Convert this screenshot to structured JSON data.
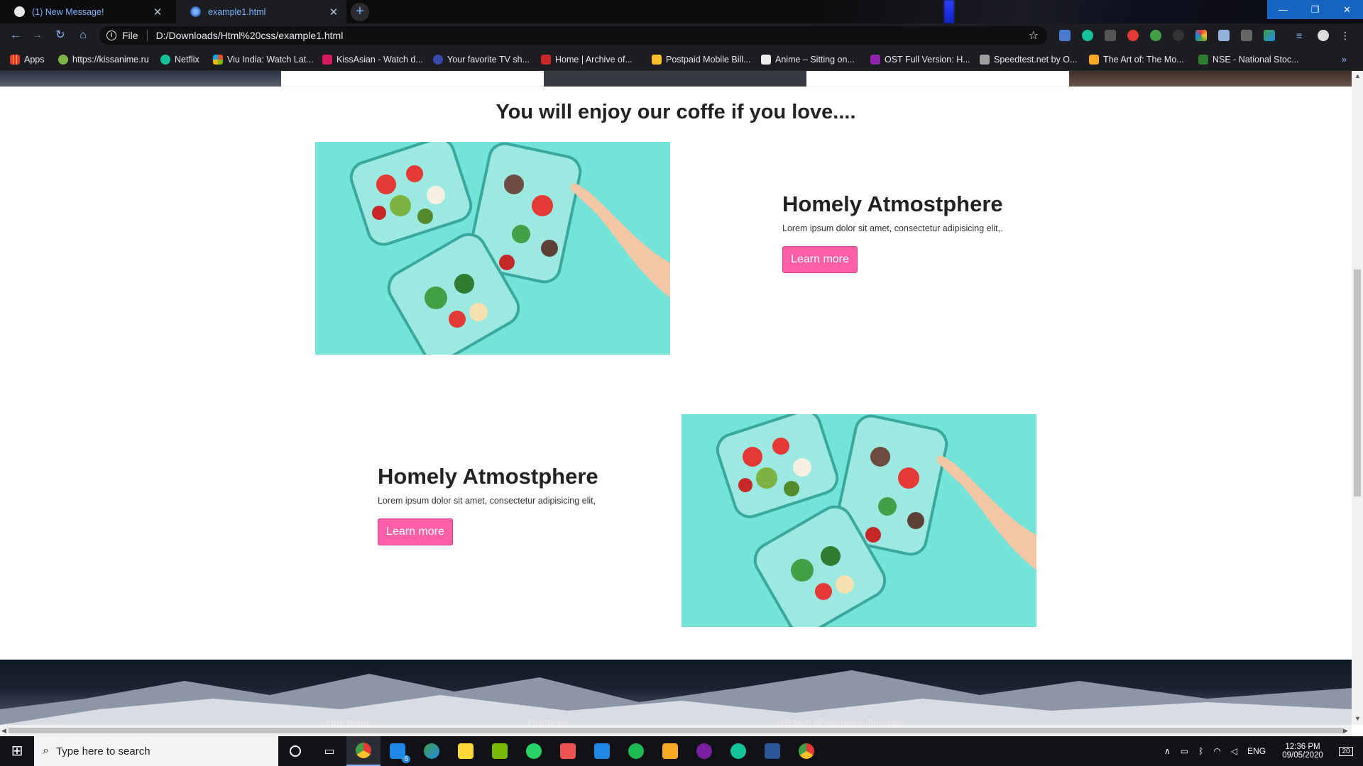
{
  "browser": {
    "tabs": [
      {
        "title": "(1) New Message!",
        "active": false
      },
      {
        "title": "example1.html",
        "active": true
      }
    ],
    "address": {
      "scheme_label": "File",
      "url": "D:/Downloads/Html%20css/example1.html"
    },
    "bookmarks": [
      "Apps",
      "https://kissanime.ru",
      "Netflix",
      "Viu India: Watch Lat...",
      "KissAsian - Watch d...",
      "Your favorite TV sh...",
      "Home | Archive of...",
      "Postpaid Mobile Bill...",
      "Anime – Sitting on...",
      "OST Full Version: H...",
      "Speedtest.net by O...",
      "The Art of: The Mo...",
      "NSE - National Stoc..."
    ],
    "bookmarks_overflow": "»"
  },
  "page": {
    "heading": "You will enjoy our coffe if you love....",
    "features": [
      {
        "title": "Homely Atmostphere",
        "description": "Lorem ipsum dolor sit amet, consectetur adipisicing elit,.",
        "button": "Learn more"
      },
      {
        "title": "Homely Atmostphere",
        "description": "Lorem ipsum dolor sit amet, consectetur adipisicing elit,",
        "button": "Learn more"
      }
    ],
    "footer": {
      "links": [
        "Our Team",
        "Our Team",
        "HTML5 eCommerce Template"
      ]
    }
  },
  "taskbar": {
    "search_placeholder": "Type here to search",
    "mail_badge": "6",
    "tray": {
      "language": "ENG",
      "time": "12:36 PM",
      "date": "09/05/2020",
      "notifications": "20"
    }
  },
  "colors": {
    "accent_button": "#ff5fa6",
    "image_bg": "#6fe0d6",
    "link_blue": "#7cb3ff",
    "window_control": "#1565c0"
  }
}
